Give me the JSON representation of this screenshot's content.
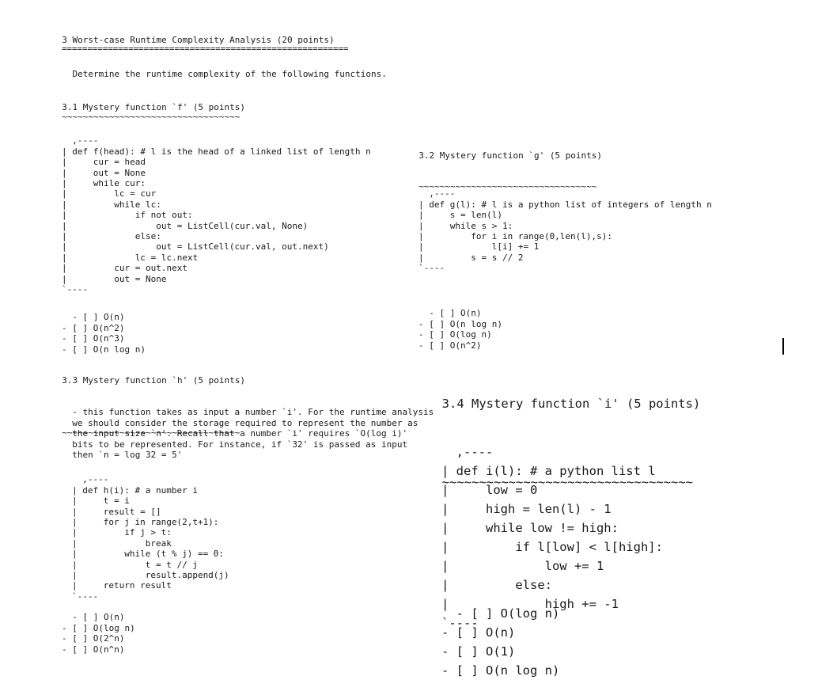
{
  "document": {
    "section_heading": "3 Worst-case Runtime Complexity Analysis (20 points)",
    "section_rule": "========================================================",
    "intro": "  Determine the runtime complexity of the following functions.",
    "subsection_rule_small": "~~~~~~~~~~~~~~~~~~~~~~~~~~~~~~~~~~~~~~~~",
    "subsection_rule_large": "~~~~~~~~~~~~~~~~~~~~~~~~~~~~~~~~~~~~~~~~"
  },
  "sections": {
    "s31": {
      "heading": "3.1 Mystery function `f' (5 points)",
      "rule": "~~~~~~~~~~~~~~~~~~~~~~~~~~~~~~~~~~",
      "code": ",----\n| def f(head): # l is the head of a linked list of length n\n|     cur = head\n|     out = None\n|     while cur:\n|         lc = cur\n|         while lc:\n|             if not out:\n|                 out = ListCell(cur.val, None)\n|             else:\n|                 out = ListCell(cur.val, out.next)\n|             lc = lc.next\n|         cur = out.next\n|         out = None\n`----",
      "options": "- [ ] O(n)\n- [ ] O(n^2)\n- [ ] O(n^3)\n- [ ] O(n log n)"
    },
    "s32": {
      "heading": "3.2 Mystery function `g' (5 points)",
      "rule": "~~~~~~~~~~~~~~~~~~~~~~~~~~~~~~~~~~",
      "code": ",----\n| def g(l): # l is a python list of integers of length n\n|     s = len(l)\n|     while s > 1:\n|         for i in range(0,len(l),s):\n|             l[i] += 1\n|         s = s // 2\n`----",
      "options": "- [ ] O(n)\n- [ ] O(n log n)\n- [ ] O(log n)\n- [ ] O(n^2)"
    },
    "s33": {
      "heading": "3.3 Mystery function `h' (5 points)",
      "rule": "~~~~~~~~~~~~~~~~~~~~~~~~~~~~~~~~~~",
      "paragraph": "- this function takes as input a number `i'. For the runtime analysis\n  we should consider the storage required to represent the number as\n  the input size `n'. Recall that a number `i' requires `O(log i)'\n  bits to be represented. For instance, if `32' is passed as input\n  then `n = log 32 = 5'",
      "code": ",----\n| def h(i): # a number i\n|     t = i\n|     result = []\n|     for j in range(2,t+1):\n|         if j > t:\n|             break\n|         while (t % j) == 0:\n|             t = t // j\n|             result.append(j)\n|     return result\n`----",
      "options": "- [ ] O(n)\n- [ ] O(log n)\n- [ ] O(2^n)\n- [ ] O(n^n)"
    },
    "s34": {
      "heading": "3.4 Mystery function `i' (5 points)",
      "rule": "~~~~~~~~~~~~~~~~~~~~~~~~~~~~~~~~~~",
      "code": ",----\n| def i(l): # a python list l\n|     low = 0\n|     high = len(l) - 1\n|     while low != high:\n|         if l[low] < l[high]:\n|             low += 1\n|         else:\n|             high += -1\n`----",
      "options": "- [ ] O(log n)\n- [ ] O(n)\n- [ ] O(1)\n- [ ] O(n log n)"
    }
  }
}
